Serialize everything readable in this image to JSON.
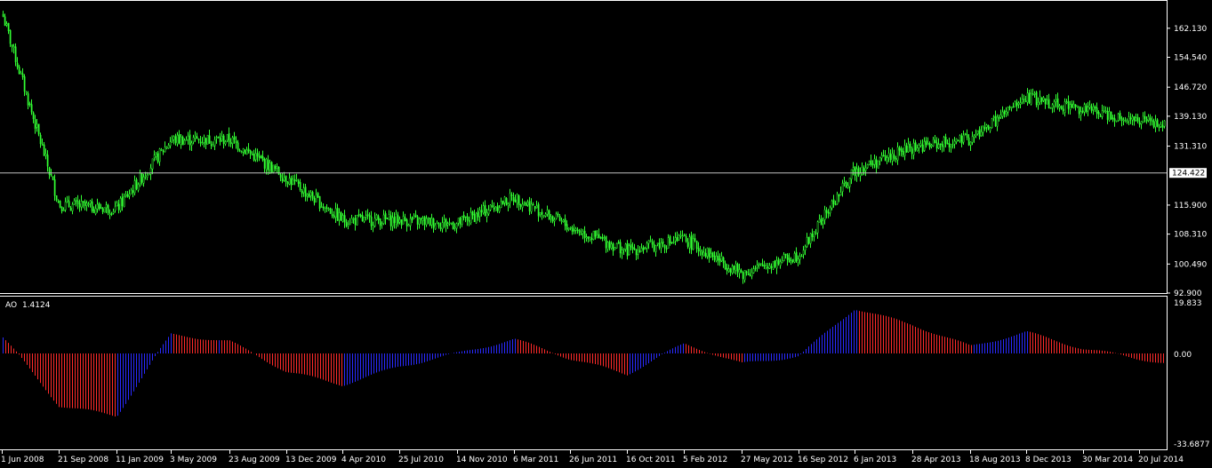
{
  "colors": {
    "background": "#000000",
    "frame": "#ffffff",
    "candle": "#33ff33",
    "ao_up": "#2a2aff",
    "ao_down": "#ff2a2a",
    "price_line": "#c0c0c0",
    "price_tag_bg": "#ffffff",
    "price_tag_text": "#000000"
  },
  "current_price": {
    "label": "124.422",
    "value": 124.422
  },
  "indicator": {
    "name": "AO",
    "value": "1.4124",
    "scale_labels": [
      "19.833",
      "0.00",
      "-33.6877"
    ]
  },
  "chart_data": [
    {
      "type": "candlestick",
      "title": "",
      "ylim": [
        91.0,
        168.0
      ],
      "y_tick_labels": [
        "162.130",
        "154.540",
        "146.720",
        "139.130",
        "131.310",
        "124.422",
        "115.900",
        "108.310",
        "100.490",
        "92.900"
      ],
      "y_tick_values": [
        162.13,
        154.54,
        146.72,
        139.13,
        131.31,
        124.422,
        115.9,
        108.31,
        100.49,
        92.9
      ],
      "x_tick_labels": [
        "1 Jun 2008",
        "21 Sep 2008",
        "11 Jan 2009",
        "3 May 2009",
        "23 Aug 2009",
        "13 Dec 2009",
        "4 Apr 2010",
        "25 Jul 2010",
        "14 Nov 2010",
        "6 Mar 2011",
        "26 Jun 2011",
        "16 Oct 2011",
        "5 Feb 2012",
        "27 May 2012",
        "16 Sep 2012",
        "6 Jan 2013",
        "28 Apr 2013",
        "18 Aug 2013",
        "8 Dec 2013",
        "30 Mar 2014",
        "20 Jul 2014"
      ],
      "approx_close_at_ticks": [
        166,
        116,
        115,
        133,
        133,
        123,
        112,
        112,
        111,
        118,
        110,
        104,
        107,
        98,
        103,
        125,
        131,
        133,
        144,
        141,
        138
      ]
    },
    {
      "type": "bar",
      "title": "AO 1.4124",
      "ylim": [
        -33.6877,
        19.833
      ],
      "x_tick_labels": [
        "1 Jun 2008",
        "21 Sep 2008",
        "11 Jan 2009",
        "3 May 2009",
        "23 Aug 2009",
        "13 Dec 2009",
        "4 Apr 2010",
        "25 Jul 2010",
        "14 Nov 2010",
        "6 Mar 2011",
        "26 Jun 2011",
        "16 Oct 2011",
        "5 Feb 2012",
        "27 May 2012",
        "16 Sep 2012",
        "6 Jan 2013",
        "28 Apr 2013",
        "18 Aug 2013",
        "8 Dec 2013",
        "30 Mar 2014",
        "20 Jul 2014"
      ],
      "approx_values_at_ticks": [
        7,
        -20,
        -24,
        8,
        5,
        -7,
        -12,
        -5,
        0,
        6,
        -2,
        -8,
        4,
        -4,
        -1,
        19,
        12,
        3,
        9,
        2,
        -2
      ],
      "series": [
        {
          "name": "",
          "color_rule": "blue when higher than previous bar, red when lower"
        }
      ]
    }
  ]
}
